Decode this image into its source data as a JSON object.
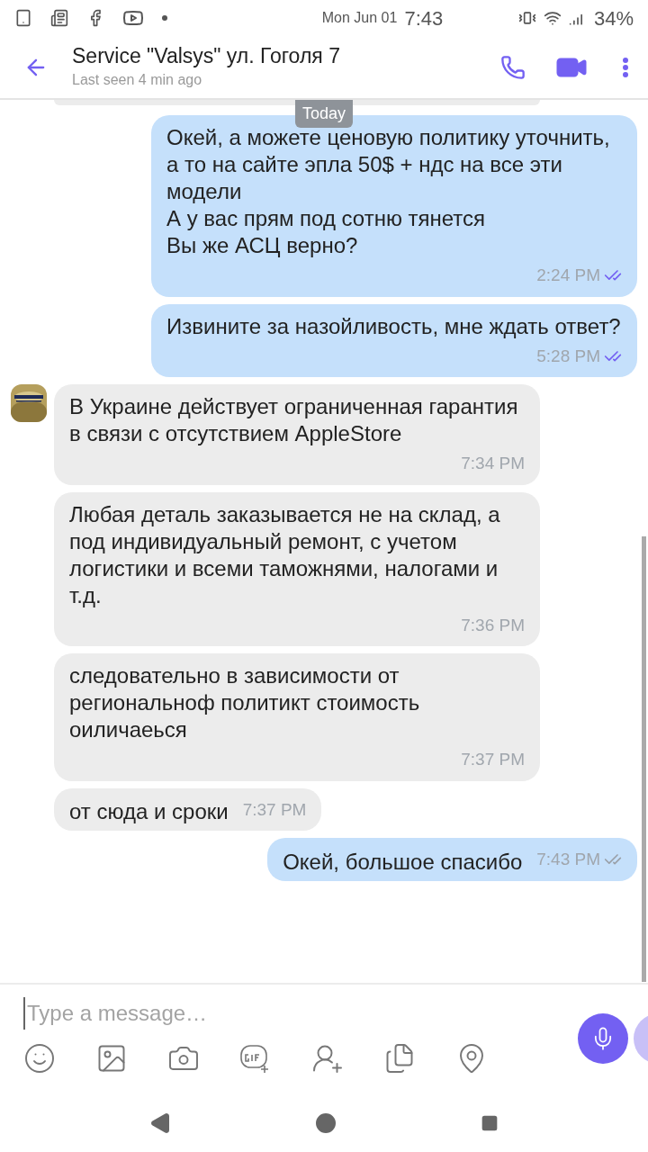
{
  "status_bar": {
    "date": "Mon Jun 01",
    "time": "7:43",
    "battery": "34%"
  },
  "header": {
    "title": "Service \"Valsys\" ул. Гоголя 7",
    "subtitle": "Last seen 4 min ago"
  },
  "date_badge": "Today",
  "messages": [
    {
      "kind": "outgoing",
      "text": "Окей, а можете ценовую политику уточнить, а то на сайте эпла 50$ + ндс на все эти модели\nА у вас прям под сотню тянется\nВы же АСЦ верно?",
      "time": "2:24 PM",
      "seen": true
    },
    {
      "kind": "outgoing",
      "text": "Извините за назойливость, мне ждать ответ?",
      "time": "5:28 PM",
      "seen": true
    },
    {
      "kind": "incoming",
      "avatar": true,
      "text": "В Украине действует ограниченная гарантия в связи с отсутствием AppleStore",
      "time": "7:34 PM"
    },
    {
      "kind": "incoming",
      "avatar": false,
      "text": "Любая деталь заказывается не на склад, а под индивидуальный ремонт, с учетом логистики и всеми таможнями, налогами и т.д.",
      "time": "7:36 PM"
    },
    {
      "kind": "incoming",
      "avatar": false,
      "text": "следовательно в зависимости от региональноф политикт стоимость оиличаеься",
      "time": "7:37 PM"
    },
    {
      "kind": "incoming",
      "avatar": false,
      "text": "от сюда и сроки",
      "time": "7:37 PM"
    },
    {
      "kind": "outgoing",
      "text": "Окей, большое спасибо",
      "time": "7:43 PM",
      "seen": false
    }
  ],
  "composer": {
    "placeholder": "Type a message…"
  }
}
